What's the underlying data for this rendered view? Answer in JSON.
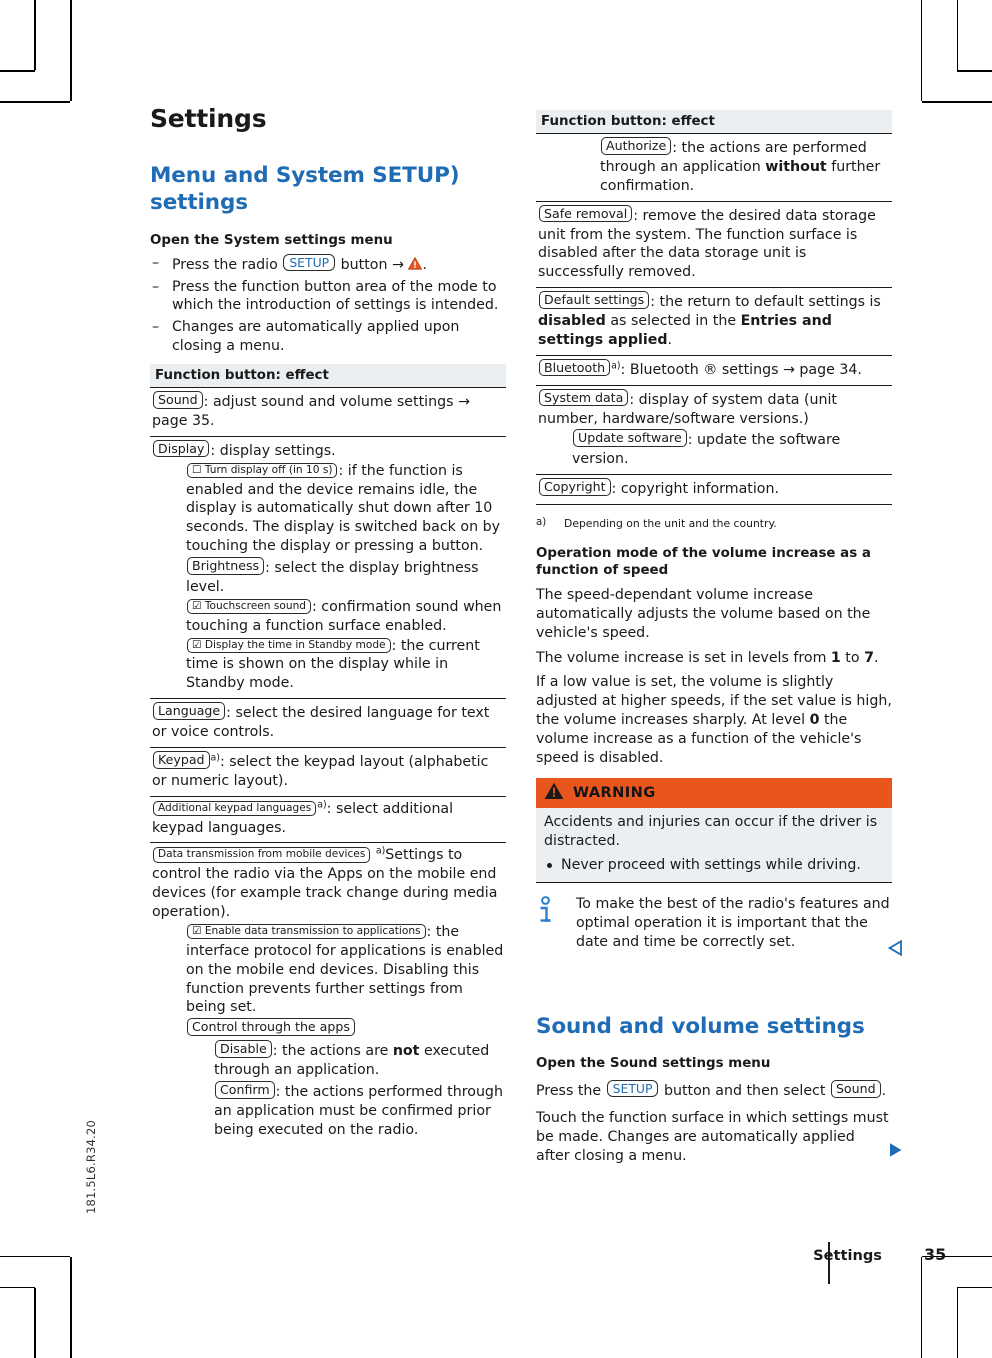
{
  "doc_code": "181.5L6.R34.20",
  "footer": {
    "section": "Settings",
    "page": "35"
  },
  "left": {
    "title": "Settings",
    "section_heading": "Menu and System SETUP) settings",
    "open_menu_heading": "Open the System settings menu",
    "steps": [
      {
        "pre": "Press the radio ",
        "key": "SETUP",
        "post": " button → ",
        "icon": "warning-triangle-icon",
        "end": "."
      },
      {
        "text": "Press the function button area of the mode to which the introduction of settings is intended."
      },
      {
        "text": "Changes are automatically applied upon closing a menu."
      }
    ],
    "table_header": "Function button: effect",
    "rows": [
      {
        "id": "sound",
        "key": "Sound",
        "text": ": adjust sound and volume settings → page 35."
      },
      {
        "id": "display",
        "key": "Display",
        "text": ": display settings.",
        "children": [
          {
            "key": "☐ Turn display off (in 10 s)",
            "key_style": "small",
            "text": ": if the function is enabled and the device remains idle, the display is automatically shut down after 10 seconds. The display is switched back on by touching the display or pressing a button."
          },
          {
            "key": "Brightness",
            "key_style": "mid",
            "text": ": select the display brightness level."
          },
          {
            "key": "☑ Touchscreen sound",
            "key_style": "small",
            "text": ": confirmation sound when touching a function surface enabled."
          },
          {
            "key": "☑ Display the time in Standby mode",
            "key_style": "small",
            "text": ": the current time is shown on the display while in Standby mode."
          }
        ]
      },
      {
        "id": "language",
        "key": "Language",
        "text": ": select the desired language for text or voice controls."
      },
      {
        "id": "keypad",
        "key": "Keypad",
        "footnote": "a)",
        "text": ": select the keypad layout (alphabetic or numeric layout)."
      },
      {
        "id": "additional-keypad-languages",
        "key": "Additional keypad languages",
        "key_style": "small",
        "footnote": "a)",
        "text": ": select additional keypad languages."
      },
      {
        "id": "data-transmission",
        "key": "Data transmission from mobile devices",
        "key_style": "small",
        "footnote": "a)",
        "text": "Settings to control the radio via the Apps on the mobile end devices (for example track change during media operation).",
        "children": [
          {
            "key": "☑ Enable data transmission to applications",
            "key_style": "small",
            "text": ": the interface protocol for applications is enabled on the mobile end devices. Disabling this function prevents further settings from being set."
          },
          {
            "key": "Control through the apps",
            "key_style": "mid",
            "text": "",
            "grandchildren": [
              {
                "key": "Disable",
                "key_style": "mid",
                "text_pre": ": the actions are ",
                "bold": "not",
                "text_post": " executed through an application."
              },
              {
                "key": "Confirm",
                "key_style": "mid",
                "text": ": the actions performed through an application must be confirmed prior being executed on the radio."
              }
            ]
          }
        ]
      }
    ]
  },
  "right": {
    "table_header": "Function button: effect",
    "rows": [
      {
        "id": "authorize",
        "indent": 2,
        "key": "Authorize",
        "key_style": "mid",
        "text_pre": ": the actions are performed through an application ",
        "bold": "without",
        "text_post": " further confirmation."
      },
      {
        "id": "safe-removal",
        "key": "Safe removal",
        "key_style": "mid",
        "text": ": remove the desired data storage unit from the system. The function surface is disabled after the data storage unit is successfully removed."
      },
      {
        "id": "default-settings",
        "key": "Default settings",
        "key_style": "mid",
        "text_pre": ": the return to default settings is ",
        "bold": "disabled",
        "text_mid": " as selected in the ",
        "bold2": "Entries and settings applied",
        "text_post": "."
      },
      {
        "id": "bluetooth",
        "key": "Bluetooth",
        "key_style": "mid",
        "footnote": "a)",
        "text": ": Bluetooth ® settings → page 34."
      },
      {
        "id": "system-data",
        "key": "System data",
        "key_style": "mid",
        "text": ": display of system data (unit number, hardware/software versions.)",
        "children": [
          {
            "key": "Update software",
            "key_style": "mid",
            "text": ": update the software version."
          }
        ]
      },
      {
        "id": "copyright",
        "key": "Copyright",
        "key_style": "mid",
        "text": ": copyright information."
      }
    ],
    "footnote_mark": "a)",
    "footnote_text": "Depending on the unit and the country.",
    "speed_heading": "Operation mode of the volume increase as a function of speed",
    "speed_p1": "The speed-dependant volume increase automatically adjusts the volume based on the vehicle's speed.",
    "speed_p2_pre": "The volume increase is set in levels from ",
    "speed_p2_b1": "1",
    "speed_p2_mid": " to ",
    "speed_p2_b2": "7",
    "speed_p2_post": ".",
    "speed_p3_pre": "If a low value is set, the volume is slightly adjusted at higher speeds, if the set value is high, the volume increases sharply. At level ",
    "speed_p3_b": "0",
    "speed_p3_post": " the volume increase as a function of the vehicle's speed is disabled.",
    "warning": {
      "icon": "warning-triangle-icon",
      "label": "WARNING",
      "body": "Accidents and injuries can occur if the driver is distracted.",
      "bullets": [
        "Never proceed with settings while driving."
      ]
    },
    "note": {
      "icon": "info-icon",
      "text": "To make the best of the radio's features and optimal operation it is important that the date and time be correctly set."
    },
    "sound_heading": "Sound and volume settings",
    "sound_sub": "Open the Sound settings menu",
    "sound_p1_pre": "Press the ",
    "sound_p1_key1": "SETUP",
    "sound_p1_mid": " button and then select ",
    "sound_p1_key2": "Sound",
    "sound_p1_post": ".",
    "sound_p2": "Touch the function surface in which settings must be made. Changes are automatically applied after closing a menu."
  },
  "icons": {
    "nav_prev": "triangle-left-outline-icon",
    "nav_next": "triangle-right-solid-icon"
  },
  "colors": {
    "heading_blue": "#1f6cb4",
    "warning_orange": "#e8561e",
    "table_head_bg": "#eceff1"
  }
}
